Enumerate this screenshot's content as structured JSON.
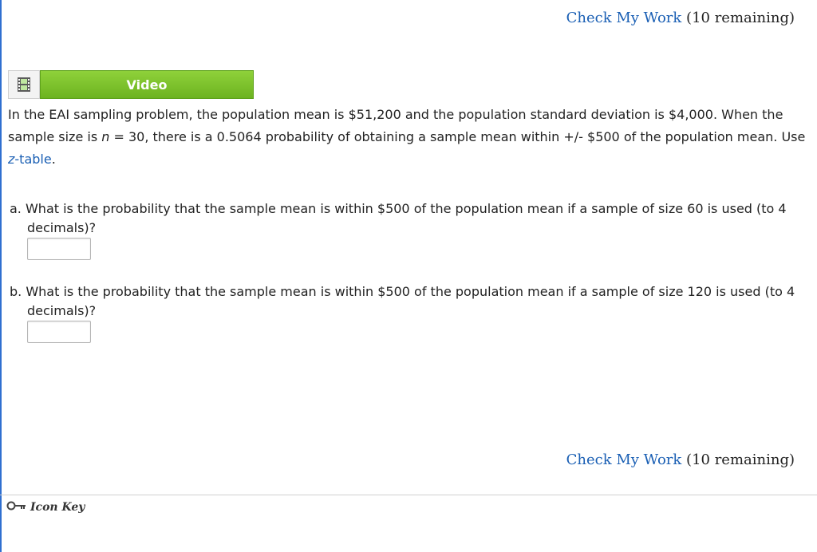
{
  "check_work": {
    "link": "Check My Work",
    "remaining": "(10 remaining)"
  },
  "video": {
    "label": "Video",
    "icon": "film-icon"
  },
  "intro": {
    "part1": "In the EAI sampling problem, the population mean is $51,200 and the population standard deviation is $4,000. When the sample size is ",
    "n_var": "n",
    "part2": " = 30, there is a 0.5064 probability of obtaining a sample mean within +/- $500 of the population mean. Use ",
    "z_var": "z",
    "table_link": "-table",
    "end": "."
  },
  "questions": [
    {
      "text": "a. What is the probability that the sample mean is within $500 of the population mean if a sample of size 60 is used (to 4 decimals)?",
      "value": ""
    },
    {
      "text": "b. What is the probability that the sample mean is within $500 of the population mean if a sample of size 120 is used (to 4 decimals)?",
      "value": ""
    }
  ],
  "footer": {
    "icon_key": "Icon Key",
    "icon": "key-icon"
  }
}
